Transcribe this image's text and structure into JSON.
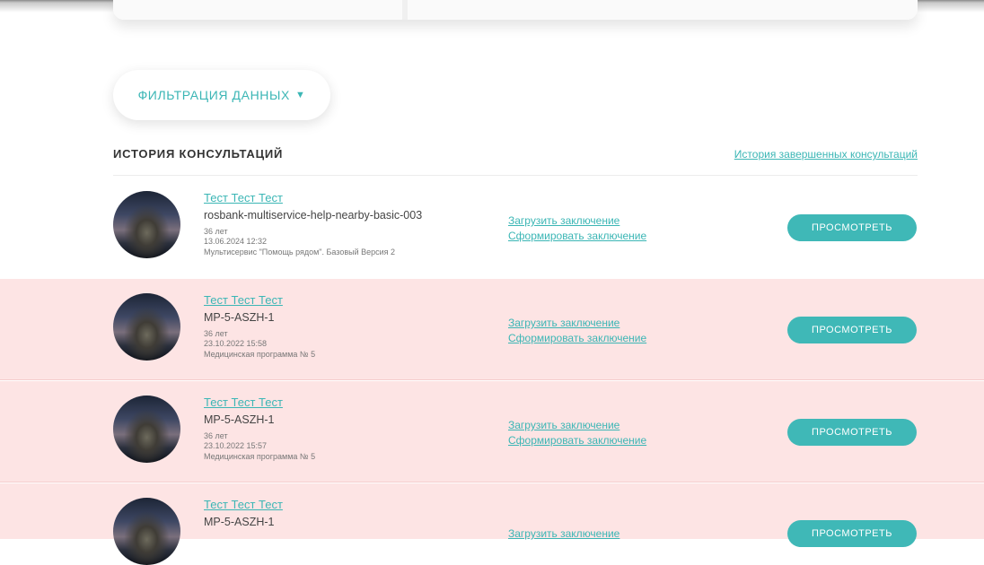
{
  "filter": {
    "label": "ФИЛЬТРАЦИЯ ДАННЫХ",
    "arrow": "▼"
  },
  "section": {
    "title": "ИСТОРИЯ КОНСУЛЬТАЦИЙ",
    "history_link": "История завершенных консультаций"
  },
  "rows": [
    {
      "name": "Тест Тест Тест",
      "code": "rosbank-multiservice-help-nearby-basic-003",
      "age": "36 лет",
      "date": "13.06.2024 12:32",
      "program": "Мультисервис \"Помощь рядом\". Базовый Версия 2",
      "upload": "Загрузить заключение",
      "form": "Сформировать заключение",
      "view": "ПРОСМОТРЕТЬ"
    },
    {
      "name": "Тест Тест Тест",
      "code": "MP-5-ASZH-1",
      "age": "36 лет",
      "date": "23.10.2022 15:58",
      "program": "Медицинская программа № 5",
      "upload": "Загрузить заключение",
      "form": "Сформировать заключение",
      "view": "ПРОСМОТРЕТЬ"
    },
    {
      "name": "Тест Тест Тест",
      "code": "MP-5-ASZH-1",
      "age": "36 лет",
      "date": "23.10.2022 15:57",
      "program": "Медицинская программа № 5",
      "upload": "Загрузить заключение",
      "form": "Сформировать заключение",
      "view": "ПРОСМОТРЕТЬ"
    },
    {
      "name": "Тест Тест Тест",
      "code": "MP-5-ASZH-1",
      "upload": "Загрузить заключение",
      "view": "ПРОСМОТРЕТЬ"
    }
  ],
  "colors": {
    "accent": "#3bb6b5",
    "row_highlight": "#fde4e4"
  }
}
